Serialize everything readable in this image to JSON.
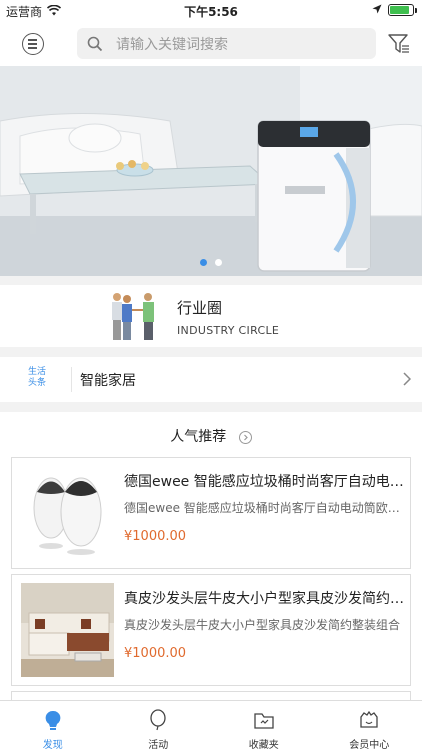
{
  "status_bar": {
    "carrier": "运营商",
    "time": "下午5:56",
    "battery_level": 0.85
  },
  "header": {
    "menu_icon": "menu-icon",
    "search_placeholder": "请输入关键词搜索",
    "filter_icon": "filter-icon"
  },
  "banner": {
    "slide_count": 2,
    "active_index": 0
  },
  "industry": {
    "title": "行业圈",
    "subtitle": "INDUSTRY CIRCLE"
  },
  "news": {
    "tag_line1": "生活",
    "tag_line2": "头条",
    "text": "智能家居"
  },
  "recommend": {
    "title": "人气推荐",
    "items": [
      {
        "title": "德国ewee 智能感应垃圾桶时尚客厅自动电动筒欧式创意",
        "desc": "德国ewee 智能感应垃圾桶时尚客厅自动电动筒欧式创意家用",
        "price": "¥1000.00"
      },
      {
        "title": "真皮沙发头层牛皮大小户型家具皮沙发简约整装",
        "desc": "真皮沙发头层牛皮大小户型家具皮沙发简约整装组合",
        "price": "¥1000.00"
      }
    ]
  },
  "tabbar": {
    "tabs": [
      {
        "label": "发现",
        "icon": "bulb-icon",
        "active": true
      },
      {
        "label": "活动",
        "icon": "balloon-icon",
        "active": false
      },
      {
        "label": "收藏夹",
        "icon": "folder-icon",
        "active": false
      },
      {
        "label": "会员中心",
        "icon": "member-icon",
        "active": false
      }
    ]
  },
  "colors": {
    "accent": "#3a8ee6",
    "price": "#e06a2e"
  }
}
